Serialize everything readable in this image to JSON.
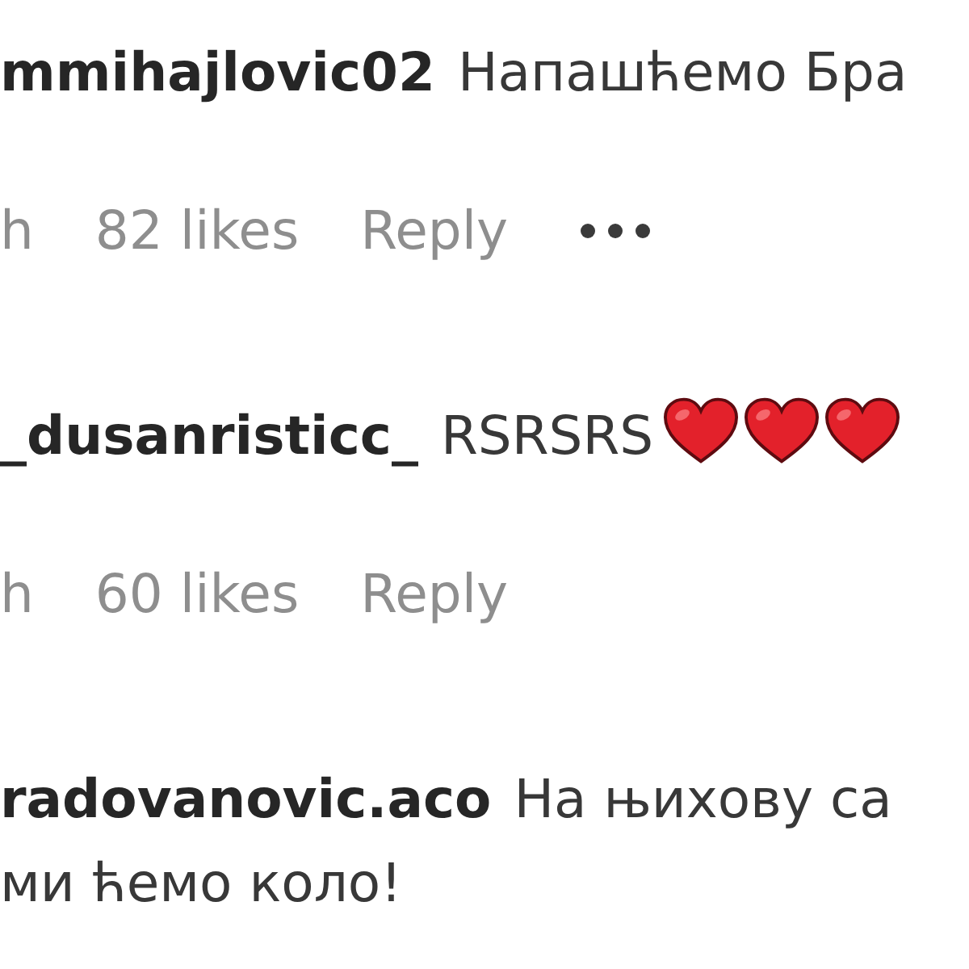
{
  "comments": [
    {
      "username": "mmihajlovic02",
      "lines": [
        "Напашћемо Бра"
      ],
      "meta": {
        "time": "h",
        "likes": "82 likes",
        "reply": "Reply",
        "more_options": true
      }
    },
    {
      "username": "_dusanristicc_",
      "lines": [
        "RSRSRS"
      ],
      "emojis": [
        {
          "kind": "heart"
        },
        {
          "kind": "heart"
        },
        {
          "kind": "heart"
        }
      ],
      "meta": {
        "time": "h",
        "likes": "60 likes",
        "reply": "Reply",
        "more_options": false
      }
    },
    {
      "username": "radovanovic.aco",
      "lines": [
        "На њихову са",
        "ми ћемо коло!"
      ]
    }
  ]
}
